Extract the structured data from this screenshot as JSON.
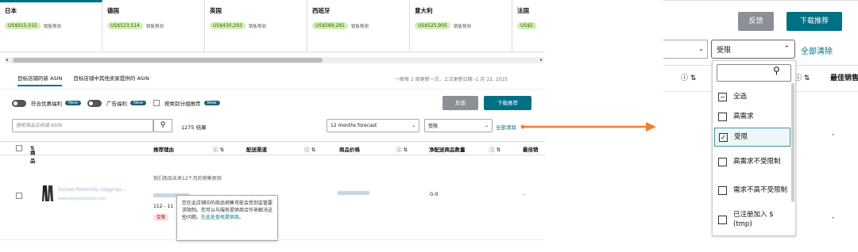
{
  "markets": [
    {
      "name": "日本",
      "value": "US$915,015",
      "label": "销售预测",
      "active": true
    },
    {
      "name": "德国",
      "value": "US$523,514",
      "label": "销售预测",
      "active": false
    },
    {
      "name": "英国",
      "value": "US$430,293",
      "label": "销售预测",
      "active": false
    },
    {
      "name": "西班牙",
      "value": "US$589,281",
      "label": "销售预测",
      "active": false
    },
    {
      "name": "意大利",
      "value": "US$525,905",
      "label": "销售预测",
      "active": false
    },
    {
      "name": "法国",
      "value": "US$5",
      "label": "",
      "active": false
    }
  ],
  "subtabs": {
    "tab1": "目标店铺的新 ASIN",
    "tab2": "目标店铺中其他卖家提供的 ASIN",
    "update_note": "一般每 2 周更新一次，上次更新日期 -1 月 22, 2025"
  },
  "filters": {
    "toggle1": "符合优惠福利",
    "toggle2": "广告福利",
    "check1": "按类别分组推荐",
    "new_badge": "New"
  },
  "buttons": {
    "feedback": "反馈",
    "download": "下载推荐",
    "clear_all": "全部清除"
  },
  "search": {
    "placeholder": "搜索商品名称或 ASIN",
    "results": "1275 结果"
  },
  "dropdowns": {
    "forecast": "12 months forecast",
    "restriction": "受限"
  },
  "table": {
    "headers": [
      "商品",
      "推荐理由",
      "配送渠道",
      "商品价格",
      "净配送商品数量",
      "最佳销"
    ]
  },
  "row1": {
    "product_title": "Sunset Maternity Leggings...",
    "product_sub": "www.amazonbrand.com",
    "reason": "我们商品未来12个月的销售预测",
    "reason2": "112 - 11",
    "tag": "受限",
    "net_qty": "0.0",
    "price_dash": "-"
  },
  "tooltip": {
    "text": "您在此店铺中的商品销售可能会受到监管要求限制。您可以与服务提供商合作来解决这些问题。",
    "link": "在此处查找提供商。"
  },
  "right_panel": {
    "feedback": "反馈",
    "download": "下载推荐",
    "clear_all": "全部清除",
    "restriction_value": "受限",
    "col_header": "最佳销售",
    "dash": "-"
  },
  "dropdown_options": [
    {
      "label": "全选",
      "state": "partial"
    },
    {
      "label": "高需求",
      "state": "unchecked"
    },
    {
      "label": "受限",
      "state": "checked"
    },
    {
      "label": "高需求不受限制",
      "state": "unchecked"
    },
    {
      "label": "需求不高不受限制",
      "state": "unchecked"
    },
    {
      "label": "已注册加入 $ (tmp)",
      "state": "unchecked"
    }
  ],
  "colors": {
    "accent": "#007185",
    "arrow": "#f08030"
  }
}
